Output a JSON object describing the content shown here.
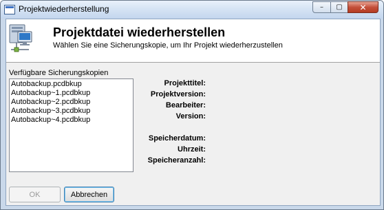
{
  "window": {
    "title": "Projektwiederherstellung",
    "controls": {
      "minimize": "–",
      "maximize": "▢",
      "close": "✕"
    }
  },
  "header": {
    "title": "Projektdatei wiederherstellen",
    "subtitle": "Wählen Sie eine Sicherungskopie, um Ihr Projekt wiederherzustellen",
    "icon": "computer-network-icon"
  },
  "backups": {
    "label": "Verfügbare Sicherungskopien",
    "items": [
      "Autobackup.pcdbkup",
      "Autobackup~1.pcdbkup",
      "Autobackup~2.pcdbkup",
      "Autobackup~3.pcdbkup",
      "Autobackup~4.pcdbkup"
    ]
  },
  "details": {
    "project_title": "Projekttitel:",
    "project_version": "Projektversion:",
    "editor": "Bearbeiter:",
    "version": "Version:",
    "save_date": "Speicherdatum:",
    "time": "Uhrzeit:",
    "save_count": "Speicheranzahl:"
  },
  "buttons": {
    "ok": "OK",
    "cancel": "Abbrechen"
  }
}
